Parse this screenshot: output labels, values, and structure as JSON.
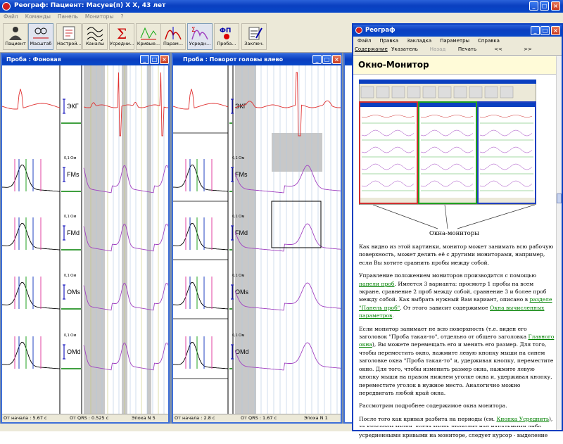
{
  "app": {
    "title": "Реограф: Пациент: Масуев(п) Х Х, 43 лет"
  },
  "menu": [
    "Файл",
    "Команды",
    "Панель",
    "Мониторы",
    "?"
  ],
  "toolbar": [
    {
      "label": "Пациент",
      "icon": "patient-icon"
    },
    {
      "label": "Фильтры\nМасштаб",
      "icon": "filter-scale-icon"
    },
    {
      "label": "Настрой...",
      "icon": "settings-icon"
    },
    {
      "label": "Каналы",
      "icon": "channels-icon"
    },
    {
      "label": "Усредни...",
      "icon": "sigma-icon"
    },
    {
      "label": "Кривые...",
      "icon": "curves-icon"
    },
    {
      "label": "Парам...",
      "icon": "params-icon"
    },
    {
      "label": "Усредн...",
      "icon": "averaged-icon"
    },
    {
      "label": "Проба...",
      "icon": "fp-icon",
      "badge": "ФП"
    },
    {
      "label": "Заключ.",
      "icon": "conclusion-icon"
    }
  ],
  "monitor1": {
    "title": "Проба : Фоновая",
    "status": {
      "start": "От начала : 5.67 с",
      "qrs": "От QRS : 0.525 с",
      "epoch": "Эпоха N 5"
    }
  },
  "monitor2": {
    "title": "Проба : Поворот головы влево",
    "status": {
      "start": "От начала : 2.8 с",
      "qrs": "От QRS : 1.67 с",
      "epoch": "Эпоха N 1"
    }
  },
  "channels": [
    {
      "label": "ЭКГ",
      "unit": ""
    },
    {
      "label": "FMs",
      "unit": "0,1 Ом"
    },
    {
      "label": "FMd",
      "unit": "0,1 Ом"
    },
    {
      "label": "OMs",
      "unit": "0,1 Ом"
    },
    {
      "label": "OMd",
      "unit": "0,1 Ом"
    }
  ],
  "colors": {
    "ecg": "#e03030",
    "rheo": "#a040c0",
    "baseline": "#008000",
    "marker": "#2020c0",
    "xp": "#0a3fc0"
  },
  "help": {
    "title": "Реограф",
    "menu": [
      "Файл",
      "Правка",
      "Закладка",
      "Параметры",
      "Справка"
    ],
    "buttons": [
      "Содержание",
      "Указатель",
      "Назад",
      "Печать",
      "<<",
      ">>"
    ],
    "heading": "Окно-Монитор",
    "figure_caption": "Окна-мониторы",
    "p1": "Как видно из этой картинки, монитор может занимать всю рабочую поверхность, может делить её с другими мониторами, например, если Вы хотите сравнить пробы между собой.",
    "p2a": "Управление положением мониторов производится с помощью ",
    "p2link1": "панели проб",
    "p2b": ". Имеется 3 варианта: просмотр 1 пробы на всем экране, сравнение 2 проб между собой, сравнение 3 и более проб между собой. Как выбрать нужный Вам вариант, описано в ",
    "p2link2": "разделе \"Панель проб\"",
    "p2c": ". От этого зависит содержимое ",
    "p2link3": "Окна вычисленных параметров",
    "p2d": ".",
    "p3a": "Если монитор занимает не всю поверхность (т.е. виден его заголовок \"Проба такая-то\", отдельно от общего заголовка ",
    "p3link": "Главного окна",
    "p3b": "), Вы можете перемещать его и менять его размер. Для того, чтобы переместить окно, нажмите левую кнопку мыши на синем заголовке окна \"Проба такая-то\" и, удерживая кнопку, переместите окно. Для того, чтобы изменить размер окна, нажмите левую кнопку мыши на правом нижнем уголке окна и, удерживая кнопку, переместите уголок в нужное место. Аналогично можно передвигать любой край окна.",
    "p4": "Рассмотрим подробнее содержимое окна монитора.",
    "p5a": "После того как кривая разбита на периоды (см. ",
    "p5link": "Кнопка Усреднить",
    "p5b": "), за курсором мыши, когда мышь проходит над начальными либо усредненными кривыми на мониторе, следует курсор - выделение"
  }
}
